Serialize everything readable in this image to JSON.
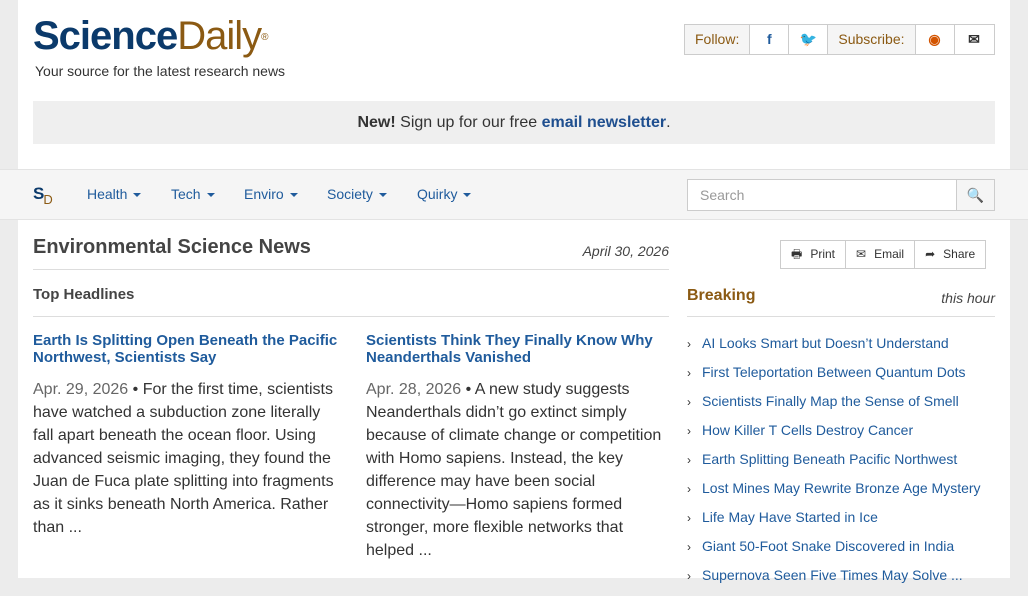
{
  "brand": {
    "name_part1": "Science",
    "name_part2": "Daily",
    "registered": "®",
    "tagline": "Your source for the latest research news"
  },
  "social": {
    "follow_label": "Follow:",
    "subscribe_label": "Subscribe:",
    "facebook_glyph": "f",
    "twitter_glyph": "🐦",
    "rss_glyph": "◉",
    "email_glyph": "✉"
  },
  "promo": {
    "new_label": "New!",
    "text": "Sign up for our free",
    "link": "email newsletter",
    "end": "."
  },
  "nav": {
    "logo_s": "S",
    "logo_d": "D",
    "items": [
      {
        "label": "Health"
      },
      {
        "label": "Tech"
      },
      {
        "label": "Enviro"
      },
      {
        "label": "Society"
      },
      {
        "label": "Quirky"
      }
    ],
    "search_placeholder": "Search",
    "search_glyph": "🔍"
  },
  "section": {
    "title": "Environmental Science News",
    "date": "April 30, 2026",
    "top_headlines": "Top Headlines"
  },
  "stories": [
    {
      "title": "Earth Is Splitting Open Beneath the Pacific Northwest, Scientists Say",
      "date": "Apr. 29, 2026",
      "summary": "For the first time, scientists have watched a subduction zone literally fall apart beneath the ocean floor. Using advanced seismic imaging, they found the Juan de Fuca plate splitting into fragments as it sinks beneath North America. Rather than ..."
    },
    {
      "title": "Scientists Think They Finally Know Why Neanderthals Vanished",
      "date": "Apr. 28, 2026",
      "summary": "A new study suggests Neanderthals didn’t go extinct simply because of climate change or competition with Homo sapiens. Instead, the key difference may have been social connectivity—Homo sapiens formed stronger, more flexible networks that helped ..."
    }
  ],
  "tools": {
    "print": "Print",
    "email": "Email",
    "share": "Share"
  },
  "breaking": {
    "title": "Breaking",
    "subtitle": "this hour",
    "items": [
      "AI Looks Smart but Doesn’t Understand",
      "First Teleportation Between Quantum Dots",
      "Scientists Finally Map the Sense of Smell",
      "How Killer T Cells Destroy Cancer",
      "Earth Splitting Beneath Pacific Northwest",
      "Lost Mines May Rewrite Bronze Age Mystery",
      "Life May Have Started in Ice",
      "Giant 50-Foot Snake Discovered in India",
      "Supernova Seen Five Times May Solve ..."
    ]
  },
  "colors": {
    "brand_blue": "#0b3a6b",
    "brand_brown": "#8b5a13",
    "link_blue": "#1f5b9c"
  }
}
